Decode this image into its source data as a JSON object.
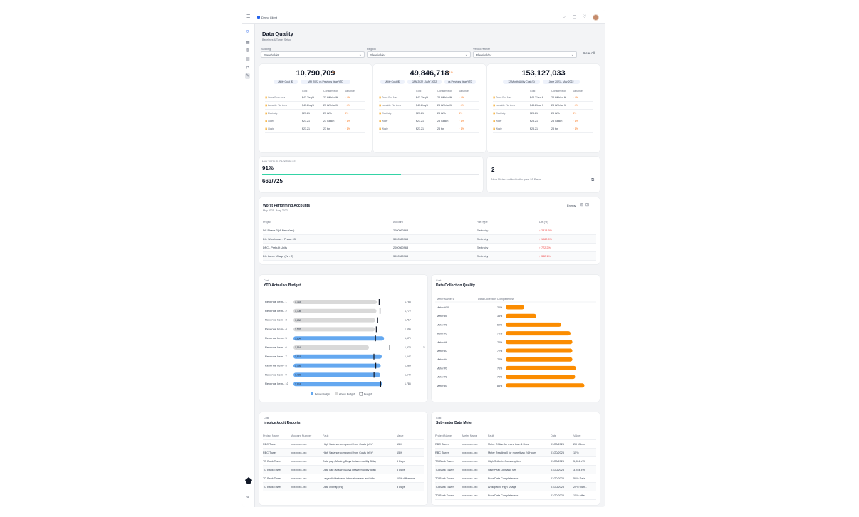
{
  "topbar": {
    "company": "Demo Client"
  },
  "page": {
    "title": "Data Quality",
    "subtitle": "Baselines & Target Setup"
  },
  "filters": {
    "building": {
      "label": "Building",
      "value": "Placeholder"
    },
    "region": {
      "label": "Region",
      "value": "Placeholder"
    },
    "vendor": {
      "label": "Vendor/Meter",
      "value": "Placeholder"
    },
    "clear": "Clear All"
  },
  "kpis": [
    {
      "value": "10,790,709",
      "delta": "↑ 4%",
      "pills": [
        "Utility Cost ($)",
        "MPI 2022 vs Previous Year YTD"
      ],
      "rows": [
        [
          "Gross Floor Area",
          "$43.2/sq/ft",
          "23 kWh/sq/ft",
          "↑ 4%"
        ],
        [
          "Leasable Flor Area",
          "$43.2/sq/ft",
          "23 kWh/sq/ft",
          "↑ 4%"
        ],
        [
          "Electricity",
          "$23.21",
          "23 kWh",
          "8%"
        ],
        [
          "Water",
          "$23.21",
          "23 Gallon",
          "↑ 1%"
        ],
        [
          "Waste",
          "$23.21",
          "23 ton",
          "↑ 1%"
        ]
      ]
    },
    {
      "value": "49,846,718",
      "delta": "↑ 1%",
      "pills": [
        "Utility Cost ($)",
        "JAN 2022 - MAY 2022",
        "vs Previous Year YTD"
      ],
      "rows": [
        [
          "Gross Flor Area",
          "$43.2/sq/ft",
          "23 kWh/sq/ft",
          "↑ 4%"
        ],
        [
          "Leasable Flor Area",
          "$43.2/sq/ft",
          "23 kWh/sq/ft",
          "↑ 4%"
        ],
        [
          "Electricity",
          "$23.21",
          "23 kWh",
          "8%"
        ],
        [
          "Water",
          "$23.21",
          "23 Gallon",
          "↑ 1%"
        ],
        [
          "Waste",
          "$23.21",
          "23 ton",
          "↑ 1%"
        ]
      ]
    },
    {
      "value": "153,127,033",
      "delta": "",
      "pills": [
        "12 Month Utility Cost ($)",
        "June 2021 - May 2022"
      ],
      "rows": [
        [
          "Gross Flor Area",
          "$43.21/sq ft",
          "23 kWh/sq ft",
          "↑ 4%"
        ],
        [
          "Leasable Flor Area",
          "$43.21/sq ft",
          "23 kWh/sq ft",
          "↑ 4%"
        ],
        [
          "Electricity",
          "$23.21",
          "23 kWh",
          "8%"
        ],
        [
          "Water",
          "$23.21",
          "23 Gallon",
          "↑ 1%"
        ],
        [
          "Waste",
          "$23.21",
          "23 ton",
          "↑ 1%"
        ]
      ]
    }
  ],
  "kpi_headers": [
    "Cost",
    "Consumption",
    "Variance"
  ],
  "coverage": {
    "label": "MAY 2022 UPLOADED BILLS",
    "percent": "91%",
    "fraction": 0.91,
    "count": "663/725"
  },
  "new_meters": {
    "value": "2",
    "label": "New Meters added in the past 90 Days"
  },
  "worst": {
    "title": "Worst Performing Accounts",
    "period": "May 2021 - May 2022",
    "filter": "Energy",
    "headers": [
      "Project",
      "Account",
      "Fuel type",
      "Diff (%)"
    ],
    "rows": [
      [
        "DC Phase-3 (A-New Yard)",
        "2000560963",
        "Electricity",
        "↑ 2313.5%"
      ],
      [
        "DI - Warehouse - Phase 03",
        "3000560963",
        "Electricity",
        "↑ 1082.5%"
      ],
      [
        "DPC - Prebuilt Units",
        "2000560963",
        "Electricity",
        "↑ 772.2%"
      ],
      [
        "DI - Labor Village (LV - 3)",
        "3000560963",
        "Electricity",
        "↑ 382.1%"
      ]
    ]
  },
  "ytd": {
    "kicker": "Cost",
    "title": "YTD Actual vs Budget",
    "legend": [
      "Below Budget",
      "Above Budget",
      "Budget"
    ],
    "items": [
      {
        "label": "Revenue Item - 1",
        "actual": "1,718",
        "budget": "1,755",
        "under": false,
        "a": 1718,
        "b": 1755
      },
      {
        "label": "Revenue Item - 2",
        "actual": "1,708",
        "budget": "1,772",
        "under": false,
        "a": 1708,
        "b": 1772
      },
      {
        "label": "Revenue Item - 3",
        "actual": "1,682",
        "budget": "1,717",
        "under": false,
        "a": 1682,
        "b": 1717
      },
      {
        "label": "Revenue Item - 4",
        "actual": "1,676",
        "budget": "1,696",
        "under": false,
        "a": 1676,
        "b": 1696
      },
      {
        "label": "Revenue Item - 5",
        "actual": "1,864",
        "budget": "1,679",
        "under": true,
        "a": 1864,
        "b": 1679
      },
      {
        "label": "Revenue Item - 6",
        "actual": "1,554",
        "budget": "1,973",
        "under": false,
        "a": 1554,
        "b": 1973
      },
      {
        "label": "Revenue Item - 7",
        "actual": "1,818",
        "budget": "1,647",
        "under": true,
        "a": 1818,
        "b": 1647
      },
      {
        "label": "Revenue Item - 8",
        "actual": "1,795",
        "budget": "1,685",
        "under": true,
        "a": 1795,
        "b": 1685
      },
      {
        "label": "Revenue Item - 9",
        "actual": "1,788",
        "budget": "1,649",
        "under": true,
        "a": 1788,
        "b": 1649
      },
      {
        "label": "Revenue Item - 10",
        "actual": "1,824",
        "budget": "1,785",
        "under": true,
        "a": 1824,
        "b": 1785
      }
    ],
    "extra_tick": "1"
  },
  "dcq": {
    "kicker": "Cost",
    "title": "Data Collection Quality",
    "headers": [
      "Meter Name",
      "Data Collection Completeness"
    ],
    "rows": [
      {
        "name": "Meter #10",
        "pct": "20%",
        "v": 20
      },
      {
        "name": "Meter #5",
        "pct": "33%",
        "v": 33
      },
      {
        "name": "Meter #8",
        "pct": "60%",
        "v": 60
      },
      {
        "name": "Meter #3",
        "pct": "70%",
        "v": 70
      },
      {
        "name": "Meter #6",
        "pct": "72%",
        "v": 72
      },
      {
        "name": "Meter #7",
        "pct": "72%",
        "v": 72
      },
      {
        "name": "Meter #4",
        "pct": "72%",
        "v": 72
      },
      {
        "name": "Meter #1",
        "pct": "76%",
        "v": 76
      },
      {
        "name": "Meter #2",
        "pct": "75%",
        "v": 75
      },
      {
        "name": "Meter #1",
        "pct": "85%",
        "v": 85
      }
    ]
  },
  "invoice": {
    "kicker": "Cost",
    "title": "Invoice Audit Reports",
    "headers": [
      "Project Name",
      "Account Number",
      "Fault",
      "Value"
    ],
    "rows": [
      [
        "RBC Tower",
        "xxx-xxxx-xxx",
        "High Variance compared from Costs (YoY)",
        "15%"
      ],
      [
        "RBC Tower",
        "xxx-xxxx-xxx",
        "High Variance compared from Costs (YoY)",
        "15%"
      ],
      [
        "TD Bank Tower",
        "xxx-xxxx-xxx",
        "Data gap (Missing Days between utility Bills)",
        "5 Days"
      ],
      [
        "TD Bank Tower",
        "xxx-xxxx-xxx",
        "Data gap (Missing Days between utility Bills)",
        "5 Days"
      ],
      [
        "TD Bank Tower",
        "xxx-xxxx-xxx",
        "Large dist between interval meters and bills",
        "10% difference"
      ],
      [
        "TD Bank Tower",
        "xxx-xxxx-xxx",
        "Data overlapping",
        "3 Days"
      ]
    ]
  },
  "submeter": {
    "kicker": "Cost",
    "title": "Sub-meter Data Meter",
    "headers": [
      "Project Name",
      "Meter Name",
      "Fault",
      "Date",
      "Value"
    ],
    "rows": [
      [
        "RBC Tower",
        "xxx-xxxx-xxx",
        "Meter Offline for more than 1 Hour",
        "01/20/2025",
        "2H 15min"
      ],
      [
        "RBC Tower",
        "xxx-xxxx-xxx",
        "Meter Reading 0 for more than 24 Hours",
        "01/20/2025",
        "15%"
      ],
      [
        "TD Bank Tower",
        "xxx-xxxx-xxx",
        "High Spike in Consumption",
        "01/20/2025",
        "5,024 kW"
      ],
      [
        "TD Bank Tower",
        "xxx-xxxx-xxx",
        "New Peak Demand Set",
        "01/20/2025",
        "3,254 kW"
      ],
      [
        "TD Bank Tower",
        "xxx-xxxx-xxx",
        "Poor Data Completeness",
        "01/20/2025",
        "50% Data..."
      ],
      [
        "TD Bank Tower",
        "xxx-xxxx-xxx",
        "Anticipated High Usage",
        "01/20/2025",
        "20% than..."
      ],
      [
        "TD Bank Tower",
        "xxx-xxxx-xxx",
        "Poor Data Completeness",
        "01/20/2025",
        "15% differ..."
      ]
    ]
  },
  "colors": {
    "accent": "#2563eb",
    "orange": "#fb8c00",
    "blue_bar": "#64a8f0",
    "grey_bar": "#d9d9d9",
    "teal": "#34d3a6"
  }
}
